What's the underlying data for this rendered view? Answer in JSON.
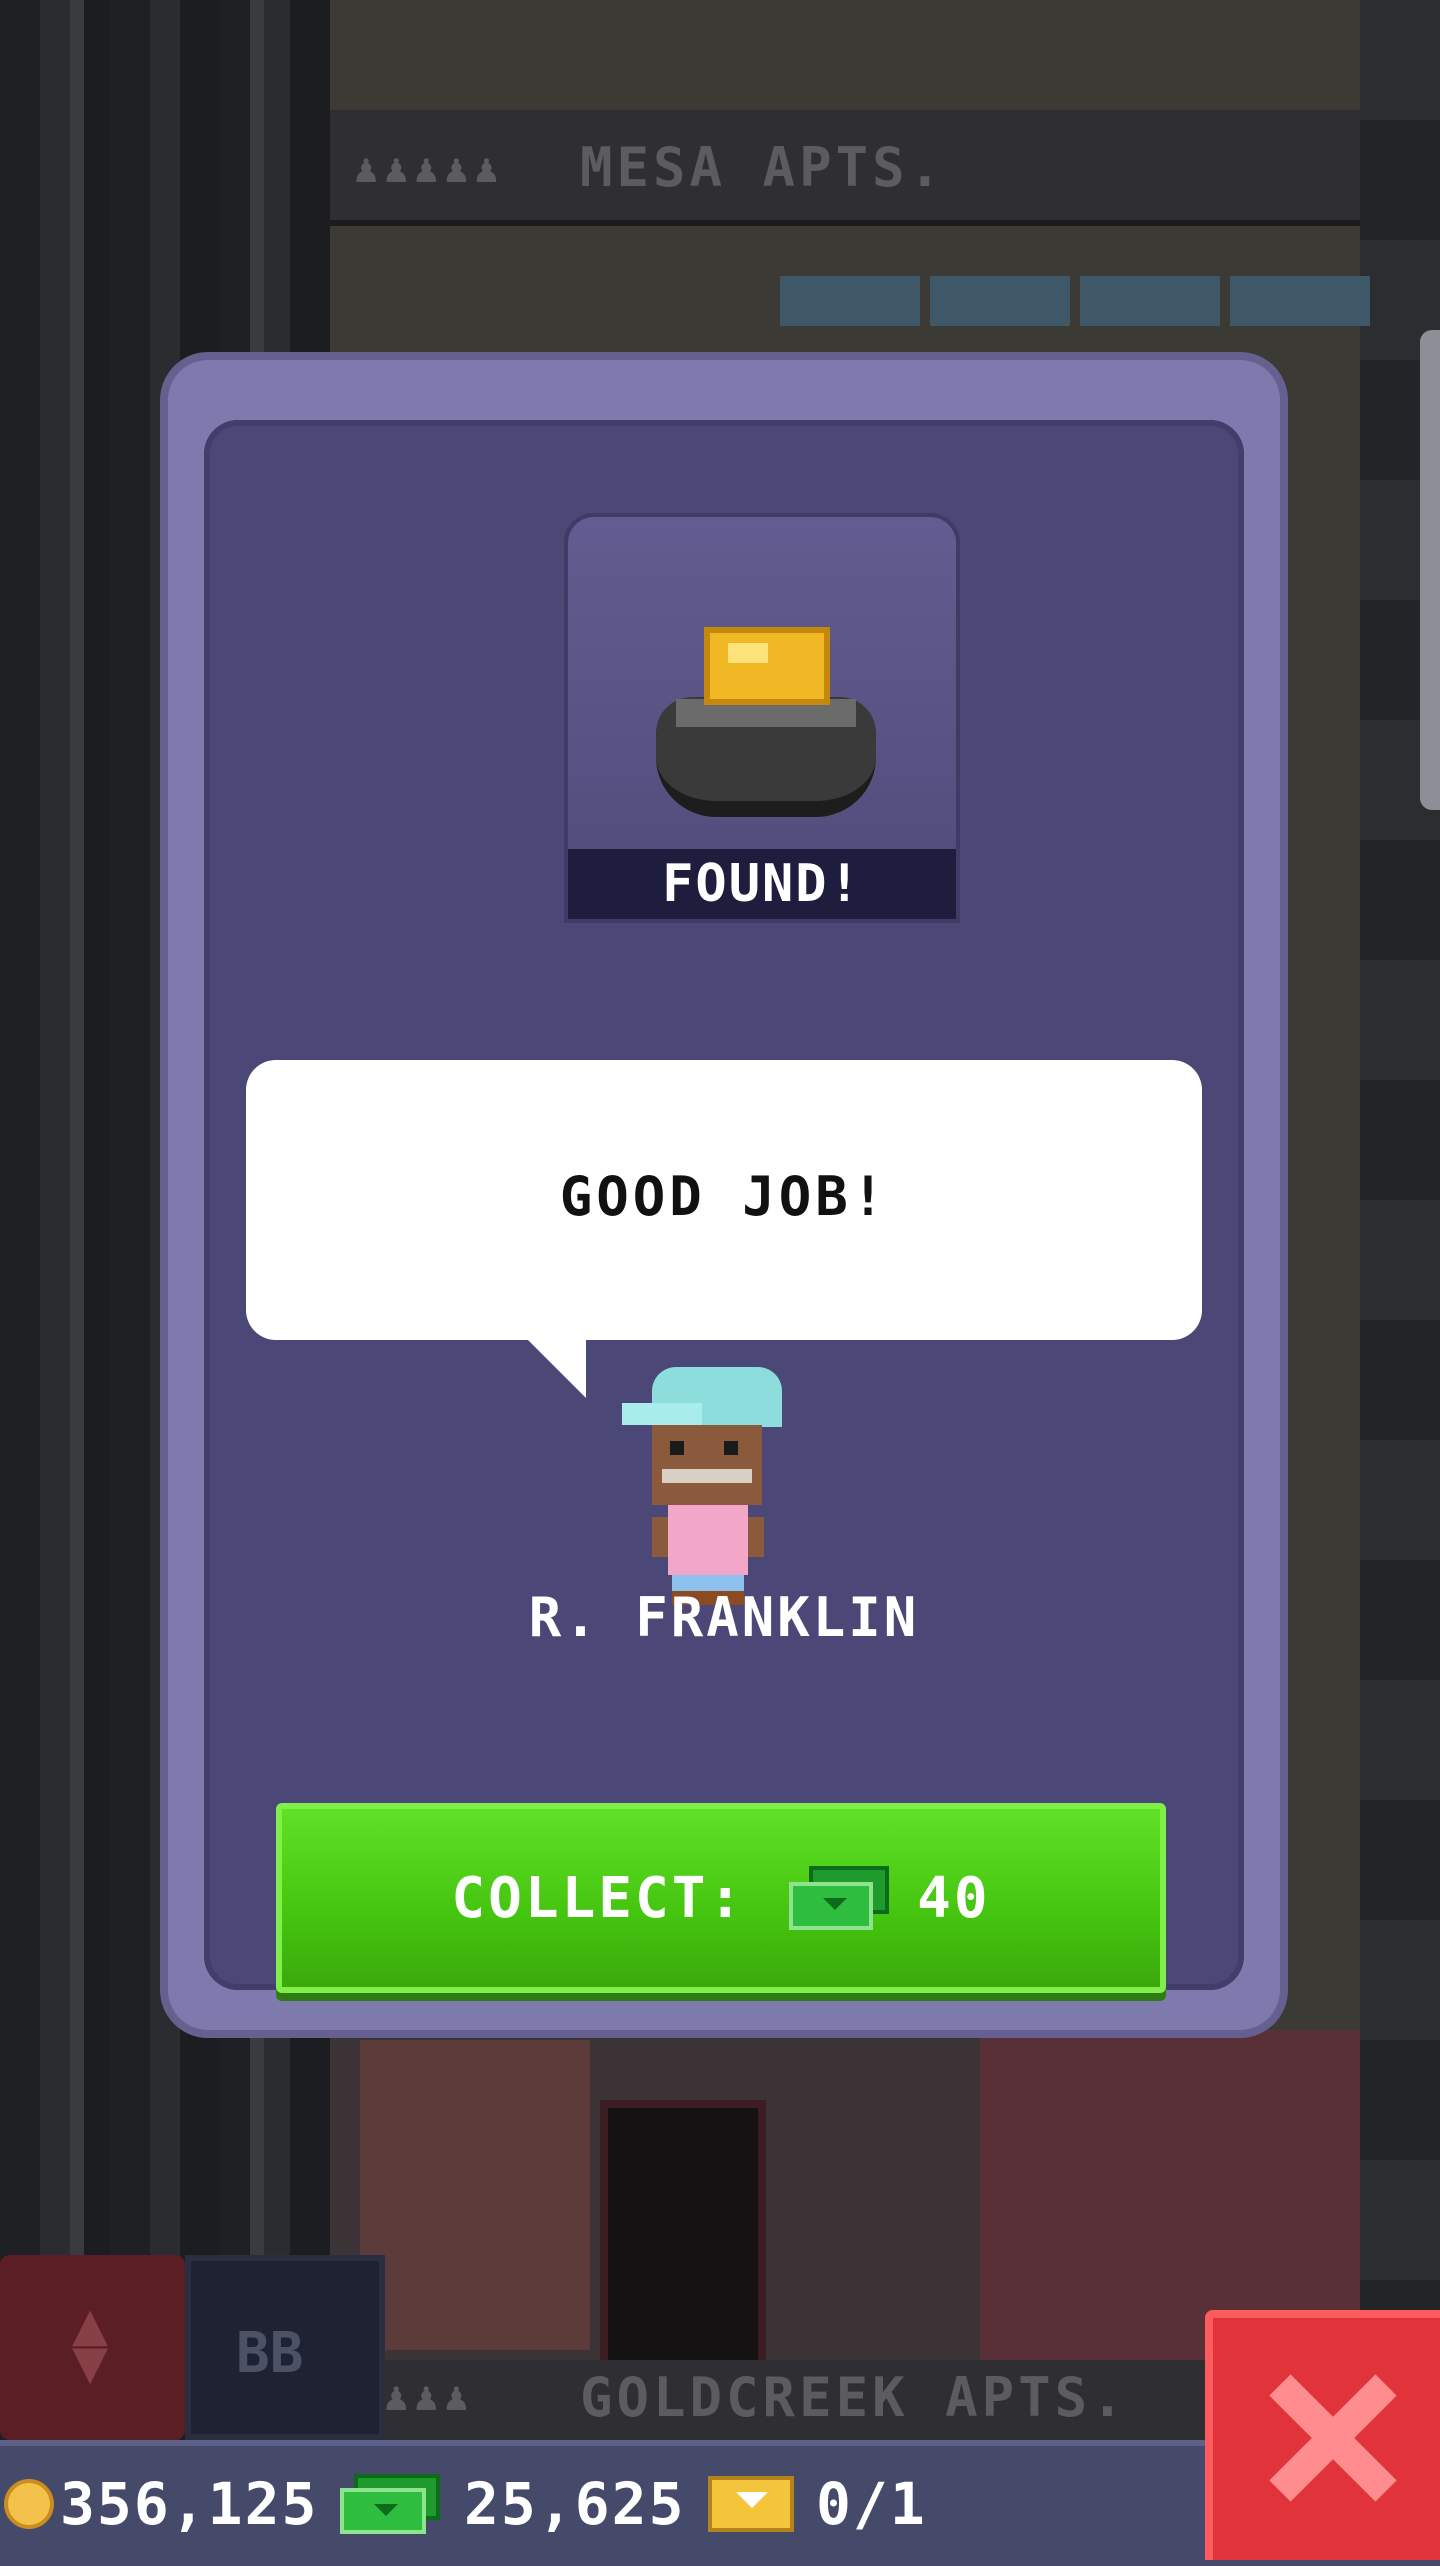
{
  "background": {
    "top_floor_sign": "MESA APTS.",
    "bottom_floor_sign": "GOLDCREEK APTS.",
    "bb_button": "BB"
  },
  "dialog": {
    "status_label": "FOUND!",
    "item_icon": "pot-of-gold-icon",
    "speech": "GOOD JOB!",
    "character_name": "R. FRANKLIN",
    "collect": {
      "label": "COLLECT:",
      "currency_icon": "bux-icon",
      "amount": "40"
    }
  },
  "hud": {
    "coins": "356,125",
    "bux": "25,625",
    "tickets": "0/1"
  },
  "colors": {
    "dialog_outer": "#7f7aae",
    "dialog_inner": "#4b4777",
    "collect_button": "#4bc814",
    "close_button": "#e0343a"
  }
}
